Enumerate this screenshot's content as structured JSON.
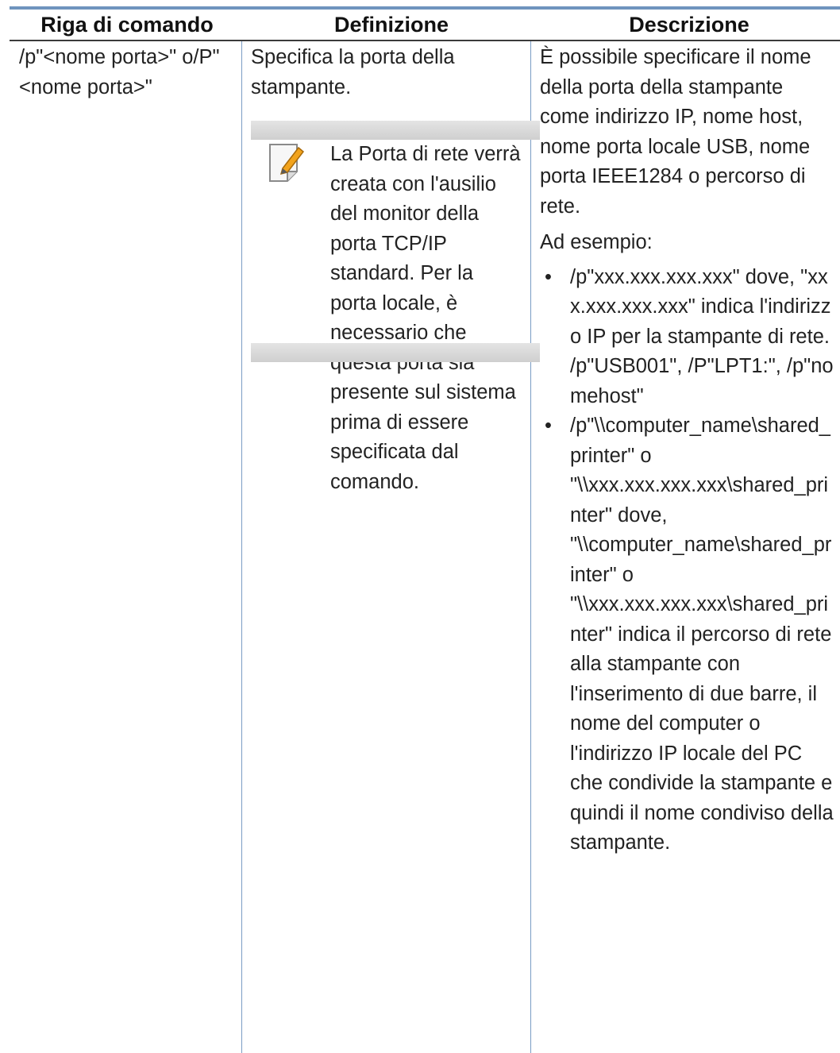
{
  "table": {
    "headers": [
      "Riga di comando",
      "Definizione",
      "Descrizione"
    ],
    "command": "/p\"<nome porta>\" o/P\"<nome porta>\"",
    "definition": "Specifica la porta della stampante.",
    "note": {
      "icon": "note-pencil-icon",
      "text": "La Porta di rete verrà creata con l'ausilio del monitor della porta TCP/IP standard. Per la porta locale, è necessario che questa porta sia presente sul sistema prima di essere specificata dal comando."
    },
    "description": {
      "intro": "È possibile specificare il nome della porta della stampante come indirizzo IP, nome host, nome porta locale USB, nome porta IEEE1284 o percorso di rete.",
      "example_label": "Ad esempio:",
      "bullets": [
        "/p\"xxx.xxx.xxx.xxx\" dove, \"xxx.xxx.xxx.xxx\" indica l'indirizzo IP per la stampante di rete. /p\"USB001\", /P\"LPT1:\", /p\"nomehost\"",
        "/p\"\\\\computer_name\\shared_printer\" o \"\\\\xxx.xxx.xxx.xxx\\shared_printer\" dove, \"\\\\computer_name\\shared_printer\" o \"\\\\xxx.xxx.xxx.xxx\\shared_printer\" indica il percorso di rete alla stampante con l'inserimento di due barre, il nome del computer o l'indirizzo IP locale del PC che condivide la stampante e quindi il nome condiviso della stampante."
      ]
    }
  },
  "colors": {
    "rule_blue": "#6f94be",
    "divider_blue": "#7a9cc4",
    "note_bar_gray": "#d6d6d6",
    "note_icon_orange": "#f2a31c"
  }
}
